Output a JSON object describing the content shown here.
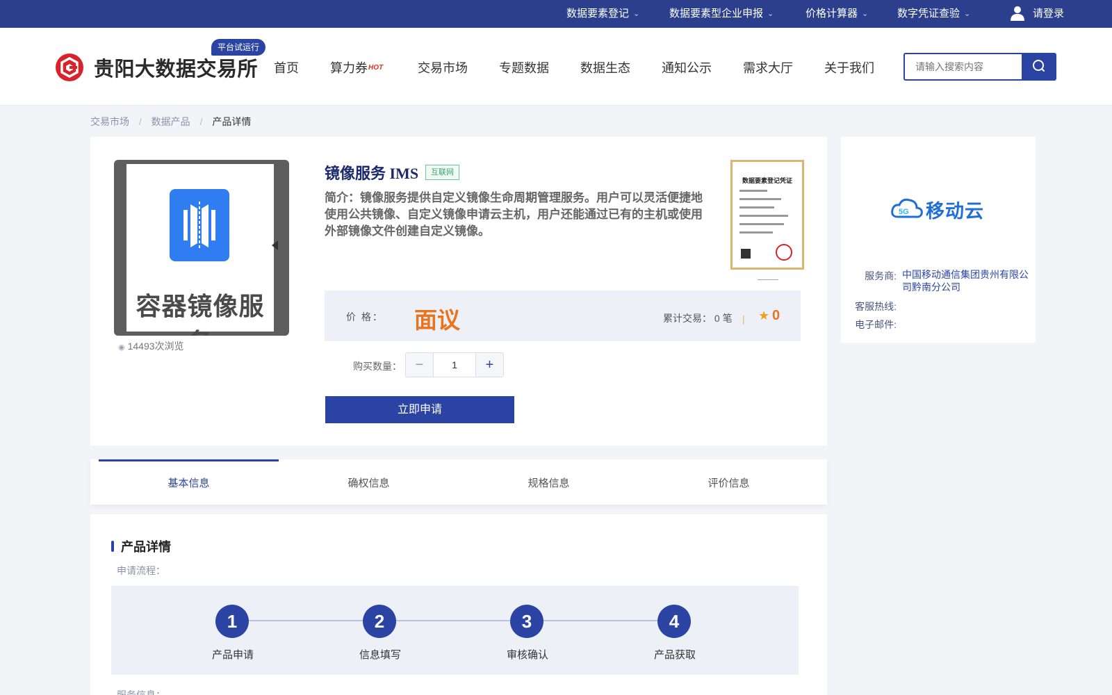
{
  "topbar": {
    "links": [
      {
        "label": "数据要素登记"
      },
      {
        "label": "数据要素型企业申报"
      },
      {
        "label": "价格计算器"
      },
      {
        "label": "数字凭证查验"
      }
    ],
    "login": "请登录"
  },
  "header": {
    "logo_text": "贵阳大数据交易所",
    "trial_badge": "平台试运行",
    "nav": [
      "首页",
      "算力券",
      "交易市场",
      "专题数据",
      "数据生态",
      "通知公示",
      "需求大厅",
      "关于我们"
    ],
    "hot_badge": "HOT",
    "search_placeholder": "请输入搜索内容"
  },
  "breadcrumb": [
    "交易市场",
    "数据产品",
    "产品详情"
  ],
  "product": {
    "image_caption": "容器镜像服务",
    "views": "14493次浏览",
    "title": "镜像服务 IMS",
    "tag": "互联网",
    "intro": "简介：镜像服务提供自定义镜像生命周期管理服务。用户可以灵活便捷地使用公共镜像、自定义镜像申请云主机，用户还能通过已有的主机或使用外部镜像文件创建自定义镜像。",
    "cert_title": "数据要素登记凭证",
    "price_label": "价 格：",
    "price_value": "面议",
    "deals": "累计交易：  0 笔",
    "divider": "|",
    "score": "0",
    "qty_label": "购买数量：",
    "qty_value": "1",
    "apply_label": "立即申请"
  },
  "vendor": {
    "logo_text": "移动云",
    "service_label": "服务商:",
    "service_value": "中国移动通信集团贵州有限公司黔南分公司",
    "hotline_label": "客服热线:",
    "email_label": "电子邮件:"
  },
  "tabs": [
    "基本信息",
    "确权信息",
    "规格信息",
    "评价信息"
  ],
  "detail": {
    "section_title": "产品详情",
    "flow_label": "申请流程：",
    "steps": [
      {
        "num": "1",
        "label": "产品申请"
      },
      {
        "num": "2",
        "label": "信息填写"
      },
      {
        "num": "3",
        "label": "审核确认"
      },
      {
        "num": "4",
        "label": "产品获取"
      }
    ],
    "service_info_label": "服务信息："
  },
  "colors": {
    "brand": "#2b44a4",
    "topbar": "#2b3f8c",
    "price": "#e8741d",
    "logo_red": "#d8232a"
  }
}
